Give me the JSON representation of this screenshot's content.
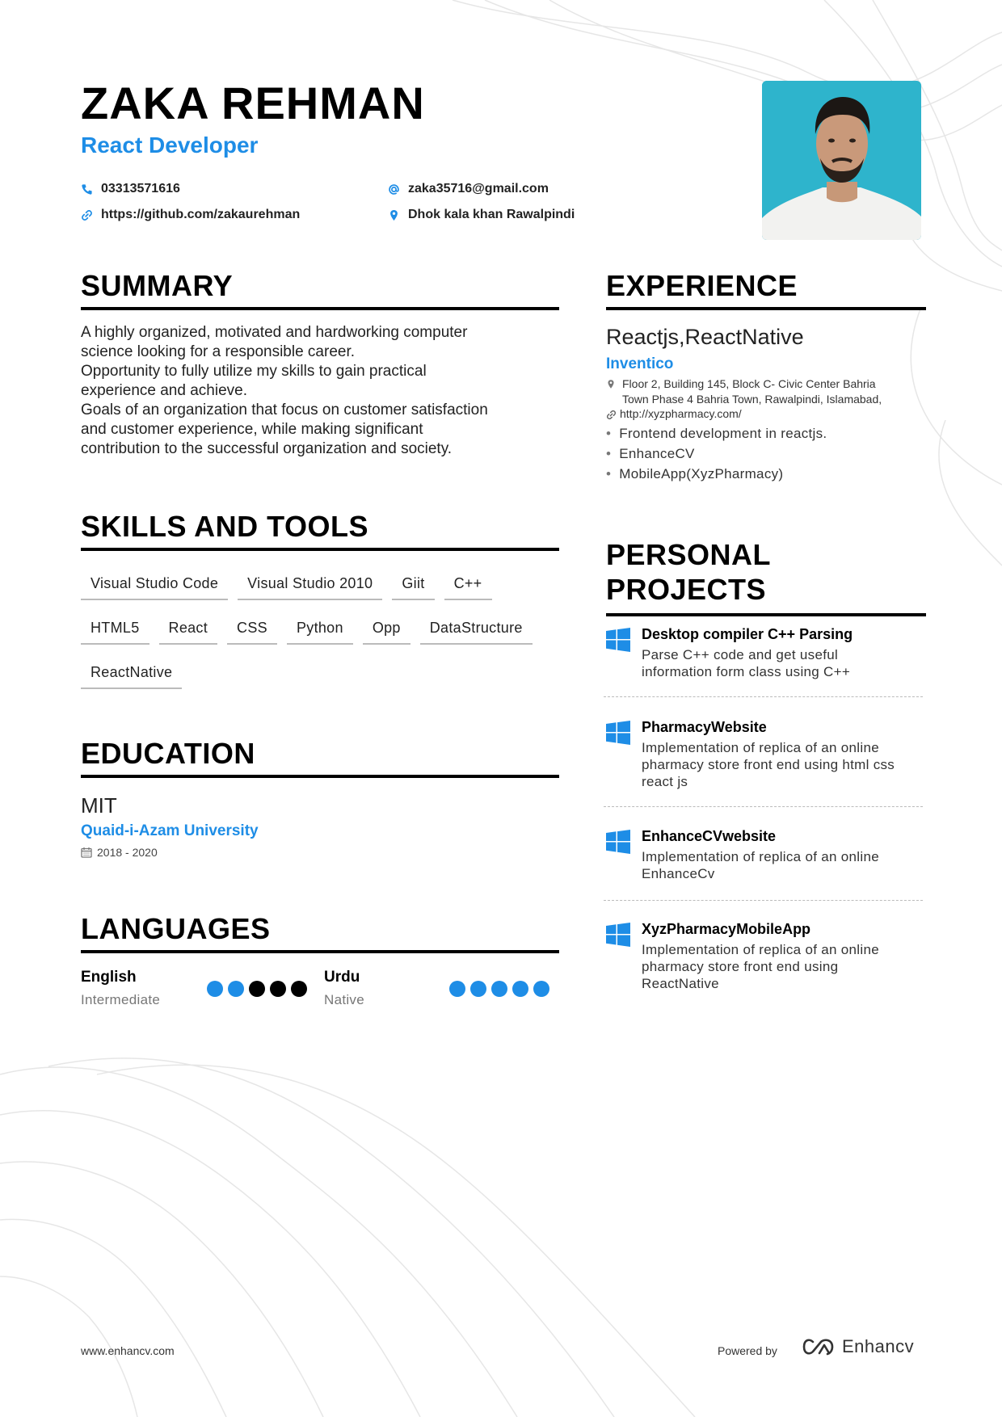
{
  "header": {
    "name": "ZAKA REHMAN",
    "role": "React Developer",
    "contacts": [
      {
        "icon": "phone-icon",
        "text": "03313571616"
      },
      {
        "icon": "at-icon",
        "text": "zaka35716@gmail.com"
      },
      {
        "icon": "link-icon",
        "text": "https://github.com/zakaurehman"
      },
      {
        "icon": "location-icon",
        "text": "Dhok kala khan Rawalpindi"
      }
    ]
  },
  "colors": {
    "accent": "#1e8de6",
    "text": "#222222",
    "rule": "#000000",
    "dot_off": "#000000"
  },
  "summary": {
    "title": "SUMMARY",
    "lines": [
      "A highly organized, motivated and hardworking computer",
      "science looking for a responsible career.",
      "Opportunity to fully utilize my skills to gain practical",
      "experience and achieve.",
      "Goals of an organization that focus on customer satisfaction",
      "and customer experience, while making significant",
      "contribution to the successful organization and society."
    ]
  },
  "skills": {
    "title": "SKILLS AND TOOLS",
    "items": [
      "Visual Studio Code",
      "Visual Studio 2010",
      "Giit",
      "C++",
      "HTML5",
      "React",
      "CSS",
      "Python",
      "Opp",
      "DataStructure",
      "ReactNative"
    ]
  },
  "education": {
    "title": "EDUCATION",
    "degree": "MIT",
    "school": "Quaid-i-Azam University",
    "dates": "2018 - 2020"
  },
  "languages": {
    "title": "LANGUAGES",
    "items": [
      {
        "name": "English",
        "level": "Intermediate",
        "rating": 2,
        "max": 5
      },
      {
        "name": "Urdu",
        "level": "Native",
        "rating": 5,
        "max": 5
      }
    ]
  },
  "experience": {
    "title": "EXPERIENCE",
    "job_title": "Reactjs,ReactNative",
    "company": "Inventico",
    "address_lines": [
      "Floor 2, Building 145, Block C- Civic Center Bahria",
      "Town Phase 4 Bahria Town, Rawalpindi, Islamabad,"
    ],
    "url": "http://xyzpharmacy.com/",
    "bullets": [
      "Frontend development in reactjs.",
      "EnhanceCV",
      "MobileApp(XyzPharmacy)"
    ]
  },
  "projects": {
    "title_line1": "PERSONAL",
    "title_line2": "PROJECTS",
    "items": [
      {
        "title": "Desktop compiler C++ Parsing",
        "desc": [
          "Parse C++ code and get useful",
          "information form class using C++"
        ]
      },
      {
        "title": "PharmacyWebsite",
        "desc": [
          "Implementation of replica of an online",
          "pharmacy store front end using html css",
          "react js"
        ]
      },
      {
        "title": "EnhanceCVwebsite",
        "desc": [
          "Implementation of replica of an online",
          "EnhanceCv"
        ]
      },
      {
        "title": "XyzPharmacyMobileApp",
        "desc": [
          "Implementation of replica of an online",
          "pharmacy store front end using",
          "ReactNative"
        ]
      }
    ]
  },
  "footer": {
    "url": "www.enhancv.com",
    "powered": "Powered by",
    "brand": "Enhancv"
  }
}
